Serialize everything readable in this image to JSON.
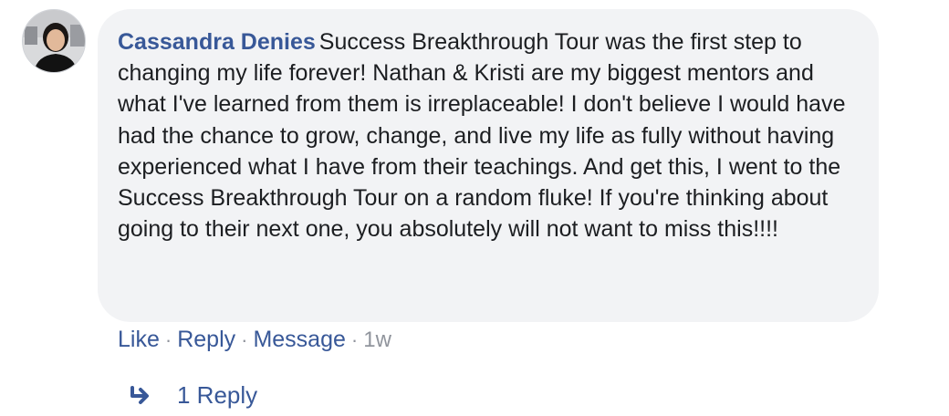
{
  "comment": {
    "author": "Cassandra Denies",
    "text": "Success Breakthrough Tour was the first step to changing my life forever! Nathan & Kristi are my biggest mentors and what I've learned from them is irreplaceable! I don't believe I would have had the chance to grow, change, and live my life as fully without having experienced what I have from their teachings. And get this, I went to the Success Breakthrough Tour on a random fluke! If you're thinking about going to their next one, you absolutely will not want to miss this!!!!"
  },
  "actions": {
    "like": "Like",
    "reply": "Reply",
    "message": "Message",
    "separator": "·",
    "timestamp": "1w"
  },
  "replies": {
    "icon": "reply-arrow-icon",
    "label": "1 Reply"
  },
  "colors": {
    "link": "#385898",
    "bubble_bg": "#f2f3f5",
    "meta_gray": "#90949c",
    "text": "#1c1e21"
  }
}
